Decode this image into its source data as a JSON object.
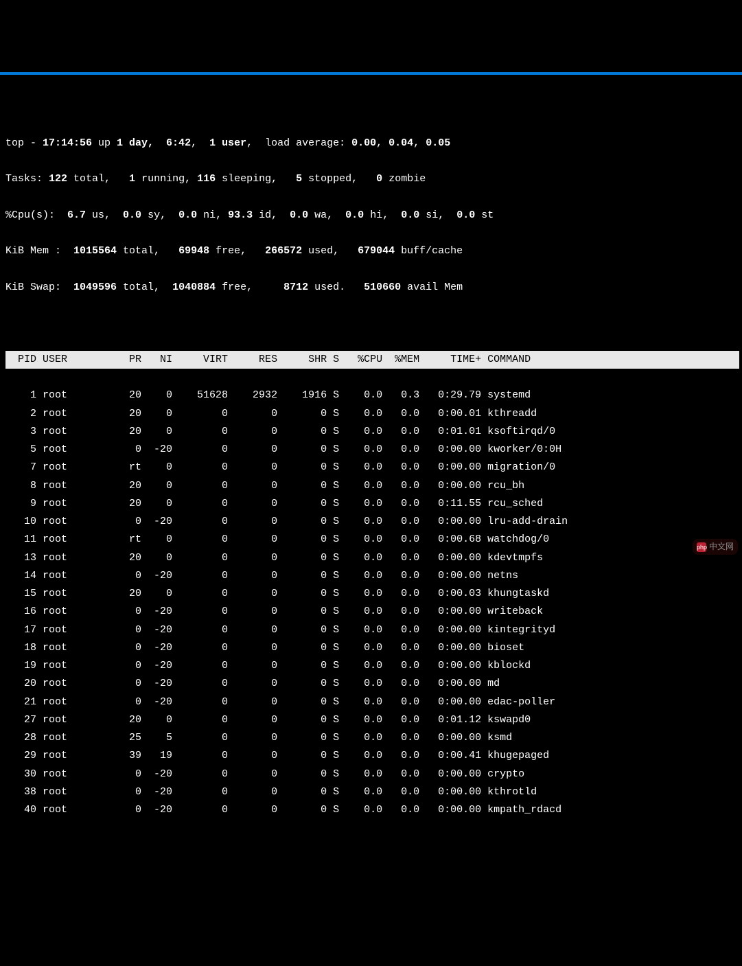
{
  "summary": {
    "line1_pre": "top - ",
    "time": "17:14:56",
    "up_pre": " up ",
    "up": "1 day,  6:42",
    "users_sep": ",  ",
    "users": "1 user",
    "load_pre": ",  load average: ",
    "load1": "0.00",
    "load_s1": ", ",
    "load2": "0.04",
    "load_s2": ", ",
    "load3": "0.05",
    "tasks_label": "Tasks: ",
    "t_total": "122",
    "t_total_l": " total,   ",
    "t_run": "1",
    "t_run_l": " running, ",
    "t_sleep": "116",
    "t_sleep_l": " sleeping,   ",
    "t_stop": "5",
    "t_stop_l": " stopped,   ",
    "t_zomb": "0",
    "t_zomb_l": " zombie",
    "cpu_label": "%Cpu(s):  ",
    "c_us": "6.7",
    "c_us_l": " us,  ",
    "c_sy": "0.0",
    "c_sy_l": " sy,  ",
    "c_ni": "0.0",
    "c_ni_l": " ni, ",
    "c_id": "93.3",
    "c_id_l": " id,  ",
    "c_wa": "0.0",
    "c_wa_l": " wa,  ",
    "c_hi": "0.0",
    "c_hi_l": " hi,  ",
    "c_si": "0.0",
    "c_si_l": " si,  ",
    "c_st": "0.0",
    "c_st_l": " st",
    "mem_label": "KiB Mem :  ",
    "m_total": "1015564",
    "m_total_l": " total,   ",
    "m_free": "69948",
    "m_free_l": " free,   ",
    "m_used": "266572",
    "m_used_l": " used,   ",
    "m_buff": "679044",
    "m_buff_l": " buff/cache",
    "swap_label": "KiB Swap:  ",
    "s_total": "1049596",
    "s_total_l": " total,  ",
    "s_free": "1040884",
    "s_free_l": " free,     ",
    "s_used": "8712",
    "s_used_l": " used.   ",
    "s_avail": "510660",
    "s_avail_l": " avail Mem"
  },
  "columns": [
    "PID",
    "USER",
    "PR",
    "NI",
    "VIRT",
    "RES",
    "SHR",
    "S",
    "%CPU",
    "%MEM",
    "TIME+",
    "COMMAND"
  ],
  "widths": [
    5,
    9,
    6,
    4,
    8,
    7,
    7,
    2,
    5,
    5,
    9,
    -1
  ],
  "aligns": [
    "r",
    "l",
    "r",
    "r",
    "r",
    "r",
    "r",
    "l",
    "r",
    "r",
    "r",
    "l"
  ],
  "rows": [
    {
      "pid": "1",
      "user": "root",
      "pr": "20",
      "ni": "0",
      "virt": "51628",
      "res": "2932",
      "shr": "1916",
      "s": "S",
      "cpu": "0.0",
      "mem": "0.3",
      "time": "0:29.79",
      "cmd": "systemd"
    },
    {
      "pid": "2",
      "user": "root",
      "pr": "20",
      "ni": "0",
      "virt": "0",
      "res": "0",
      "shr": "0",
      "s": "S",
      "cpu": "0.0",
      "mem": "0.0",
      "time": "0:00.01",
      "cmd": "kthreadd"
    },
    {
      "pid": "3",
      "user": "root",
      "pr": "20",
      "ni": "0",
      "virt": "0",
      "res": "0",
      "shr": "0",
      "s": "S",
      "cpu": "0.0",
      "mem": "0.0",
      "time": "0:01.01",
      "cmd": "ksoftirqd/0"
    },
    {
      "pid": "5",
      "user": "root",
      "pr": "0",
      "ni": "-20",
      "virt": "0",
      "res": "0",
      "shr": "0",
      "s": "S",
      "cpu": "0.0",
      "mem": "0.0",
      "time": "0:00.00",
      "cmd": "kworker/0:0H"
    },
    {
      "pid": "7",
      "user": "root",
      "pr": "rt",
      "ni": "0",
      "virt": "0",
      "res": "0",
      "shr": "0",
      "s": "S",
      "cpu": "0.0",
      "mem": "0.0",
      "time": "0:00.00",
      "cmd": "migration/0"
    },
    {
      "pid": "8",
      "user": "root",
      "pr": "20",
      "ni": "0",
      "virt": "0",
      "res": "0",
      "shr": "0",
      "s": "S",
      "cpu": "0.0",
      "mem": "0.0",
      "time": "0:00.00",
      "cmd": "rcu_bh"
    },
    {
      "pid": "9",
      "user": "root",
      "pr": "20",
      "ni": "0",
      "virt": "0",
      "res": "0",
      "shr": "0",
      "s": "S",
      "cpu": "0.0",
      "mem": "0.0",
      "time": "0:11.55",
      "cmd": "rcu_sched"
    },
    {
      "pid": "10",
      "user": "root",
      "pr": "0",
      "ni": "-20",
      "virt": "0",
      "res": "0",
      "shr": "0",
      "s": "S",
      "cpu": "0.0",
      "mem": "0.0",
      "time": "0:00.00",
      "cmd": "lru-add-drain"
    },
    {
      "pid": "11",
      "user": "root",
      "pr": "rt",
      "ni": "0",
      "virt": "0",
      "res": "0",
      "shr": "0",
      "s": "S",
      "cpu": "0.0",
      "mem": "0.0",
      "time": "0:00.68",
      "cmd": "watchdog/0"
    },
    {
      "pid": "13",
      "user": "root",
      "pr": "20",
      "ni": "0",
      "virt": "0",
      "res": "0",
      "shr": "0",
      "s": "S",
      "cpu": "0.0",
      "mem": "0.0",
      "time": "0:00.00",
      "cmd": "kdevtmpfs"
    },
    {
      "pid": "14",
      "user": "root",
      "pr": "0",
      "ni": "-20",
      "virt": "0",
      "res": "0",
      "shr": "0",
      "s": "S",
      "cpu": "0.0",
      "mem": "0.0",
      "time": "0:00.00",
      "cmd": "netns"
    },
    {
      "pid": "15",
      "user": "root",
      "pr": "20",
      "ni": "0",
      "virt": "0",
      "res": "0",
      "shr": "0",
      "s": "S",
      "cpu": "0.0",
      "mem": "0.0",
      "time": "0:00.03",
      "cmd": "khungtaskd"
    },
    {
      "pid": "16",
      "user": "root",
      "pr": "0",
      "ni": "-20",
      "virt": "0",
      "res": "0",
      "shr": "0",
      "s": "S",
      "cpu": "0.0",
      "mem": "0.0",
      "time": "0:00.00",
      "cmd": "writeback"
    },
    {
      "pid": "17",
      "user": "root",
      "pr": "0",
      "ni": "-20",
      "virt": "0",
      "res": "0",
      "shr": "0",
      "s": "S",
      "cpu": "0.0",
      "mem": "0.0",
      "time": "0:00.00",
      "cmd": "kintegrityd"
    },
    {
      "pid": "18",
      "user": "root",
      "pr": "0",
      "ni": "-20",
      "virt": "0",
      "res": "0",
      "shr": "0",
      "s": "S",
      "cpu": "0.0",
      "mem": "0.0",
      "time": "0:00.00",
      "cmd": "bioset"
    },
    {
      "pid": "19",
      "user": "root",
      "pr": "0",
      "ni": "-20",
      "virt": "0",
      "res": "0",
      "shr": "0",
      "s": "S",
      "cpu": "0.0",
      "mem": "0.0",
      "time": "0:00.00",
      "cmd": "kblockd"
    },
    {
      "pid": "20",
      "user": "root",
      "pr": "0",
      "ni": "-20",
      "virt": "0",
      "res": "0",
      "shr": "0",
      "s": "S",
      "cpu": "0.0",
      "mem": "0.0",
      "time": "0:00.00",
      "cmd": "md"
    },
    {
      "pid": "21",
      "user": "root",
      "pr": "0",
      "ni": "-20",
      "virt": "0",
      "res": "0",
      "shr": "0",
      "s": "S",
      "cpu": "0.0",
      "mem": "0.0",
      "time": "0:00.00",
      "cmd": "edac-poller"
    },
    {
      "pid": "27",
      "user": "root",
      "pr": "20",
      "ni": "0",
      "virt": "0",
      "res": "0",
      "shr": "0",
      "s": "S",
      "cpu": "0.0",
      "mem": "0.0",
      "time": "0:01.12",
      "cmd": "kswapd0"
    },
    {
      "pid": "28",
      "user": "root",
      "pr": "25",
      "ni": "5",
      "virt": "0",
      "res": "0",
      "shr": "0",
      "s": "S",
      "cpu": "0.0",
      "mem": "0.0",
      "time": "0:00.00",
      "cmd": "ksmd"
    },
    {
      "pid": "29",
      "user": "root",
      "pr": "39",
      "ni": "19",
      "virt": "0",
      "res": "0",
      "shr": "0",
      "s": "S",
      "cpu": "0.0",
      "mem": "0.0",
      "time": "0:00.41",
      "cmd": "khugepaged"
    },
    {
      "pid": "30",
      "user": "root",
      "pr": "0",
      "ni": "-20",
      "virt": "0",
      "res": "0",
      "shr": "0",
      "s": "S",
      "cpu": "0.0",
      "mem": "0.0",
      "time": "0:00.00",
      "cmd": "crypto"
    },
    {
      "pid": "38",
      "user": "root",
      "pr": "0",
      "ni": "-20",
      "virt": "0",
      "res": "0",
      "shr": "0",
      "s": "S",
      "cpu": "0.0",
      "mem": "0.0",
      "time": "0:00.00",
      "cmd": "kthrotld"
    },
    {
      "pid": "40",
      "user": "root",
      "pr": "0",
      "ni": "-20",
      "virt": "0",
      "res": "0",
      "shr": "0",
      "s": "S",
      "cpu": "0.0",
      "mem": "0.0",
      "time": "0:00.00",
      "cmd": "kmpath_rdacd"
    }
  ],
  "watermark": "中文网"
}
